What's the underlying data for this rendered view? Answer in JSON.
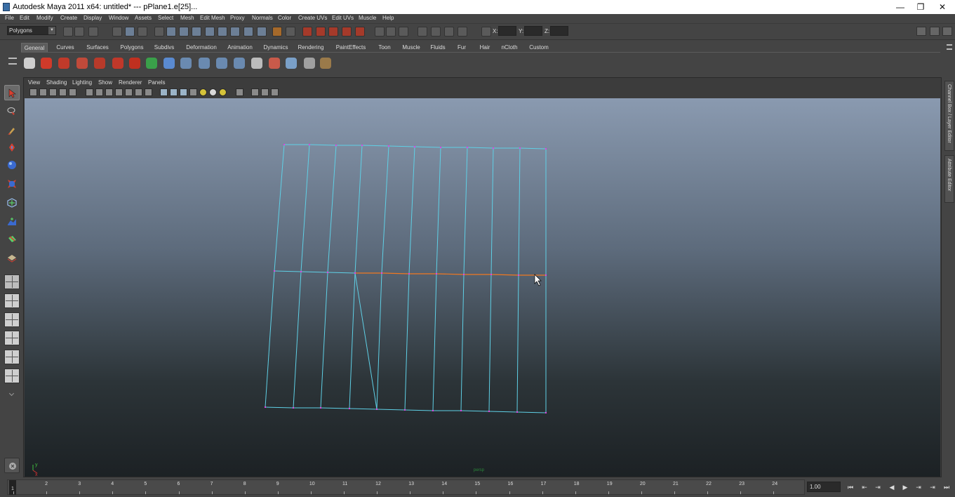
{
  "window": {
    "title": "Autodesk Maya 2011 x64: untitled*    ---    pPlane1.e[25]...",
    "minimize": "—",
    "restore": "❐",
    "close": "✕"
  },
  "menubar": {
    "items": [
      "File",
      "Edit",
      "Modify",
      "Create",
      "Display",
      "Window",
      "Assets",
      "Select",
      "Mesh",
      "Edit Mesh",
      "Proxy",
      "Normals",
      "Color",
      "Create UVs",
      "Edit UVs",
      "Muscle",
      "Help"
    ]
  },
  "statusline": {
    "mode": "Polygons",
    "x_label": "X:",
    "y_label": "Y:",
    "z_label": "Z:"
  },
  "shelf": {
    "tabs": [
      "General",
      "Curves",
      "Surfaces",
      "Polygons",
      "Subdivs",
      "Deformation",
      "Animation",
      "Dynamics",
      "Rendering",
      "PaintEffects",
      "Toon",
      "Muscle",
      "Fluids",
      "Fur",
      "Hair",
      "nCloth",
      "Custom"
    ],
    "active_tab": "General",
    "icons": [
      "sphere-checker",
      "help-question",
      "red-scissors",
      "red-star",
      "red-gear",
      "red-knot",
      "red-loop",
      "green-arrow",
      "blue-sphere",
      "blue-joint-1",
      "blue-joint-2",
      "blue-joint-3",
      "blue-joint-4",
      "list",
      "paint-tool",
      "cylinder",
      "cube-stack",
      "paint-brush"
    ],
    "colors": [
      "#cfcfcf",
      "#d03a2a",
      "#c03a2a",
      "#c04a3a",
      "#b83a2a",
      "#c0382a",
      "#c03020",
      "#3aa04a",
      "#5a8ad0",
      "#6a8ab0",
      "#6a8ab0",
      "#6a8ab0",
      "#6a8ab0",
      "#bcbcbc",
      "#c85a4a",
      "#7aa0c8",
      "#a0a0a0",
      "#9a7a4a"
    ]
  },
  "panel": {
    "menus": [
      "View",
      "Shading",
      "Lighting",
      "Show",
      "Renderer",
      "Panels"
    ]
  },
  "sidebar": {
    "tabs": [
      "Channel Box / Layer Editor",
      "Attribute Editor"
    ]
  },
  "viewport": {
    "status_text": "persp"
  },
  "timeslider": {
    "frames": [
      "1",
      "2",
      "3",
      "4",
      "5",
      "6",
      "7",
      "8",
      "9",
      "10",
      "11",
      "12",
      "13",
      "14",
      "15",
      "16",
      "17",
      "18",
      "19",
      "20",
      "21",
      "22",
      "23",
      "24"
    ],
    "current_frame": "1",
    "frame_field": "1.00",
    "buttons": [
      "⏮",
      "⇤",
      "⇥",
      "◀",
      "▶",
      "⇥",
      "⇥",
      "⏭"
    ]
  },
  "colors": {
    "wire": "#5fd0e6",
    "vertex": "#e040e0",
    "selected_edge": "#f07820"
  }
}
